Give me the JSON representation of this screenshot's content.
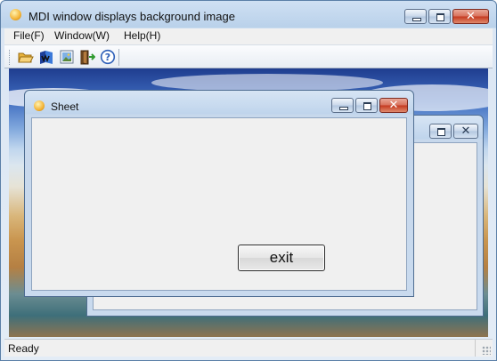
{
  "window": {
    "title": "MDI window displays background image",
    "icon": "app-face-icon"
  },
  "menu": {
    "items": [
      {
        "label": "File(F)"
      },
      {
        "label": "Window(W)"
      },
      {
        "label": "Help(H)"
      }
    ]
  },
  "toolbar": {
    "buttons": [
      {
        "icon": "open-folder-icon"
      },
      {
        "icon": "background-image-icon"
      },
      {
        "icon": "picture-icon"
      },
      {
        "icon": "exit-door-icon"
      },
      {
        "icon": "help-icon"
      }
    ]
  },
  "child_front": {
    "title": "Sheet",
    "button_label": "exit"
  },
  "child_back": {
    "title": ""
  },
  "status": {
    "text": "Ready"
  },
  "colors": {
    "accent": "#c4381e",
    "frame": "#5b7fa7"
  }
}
